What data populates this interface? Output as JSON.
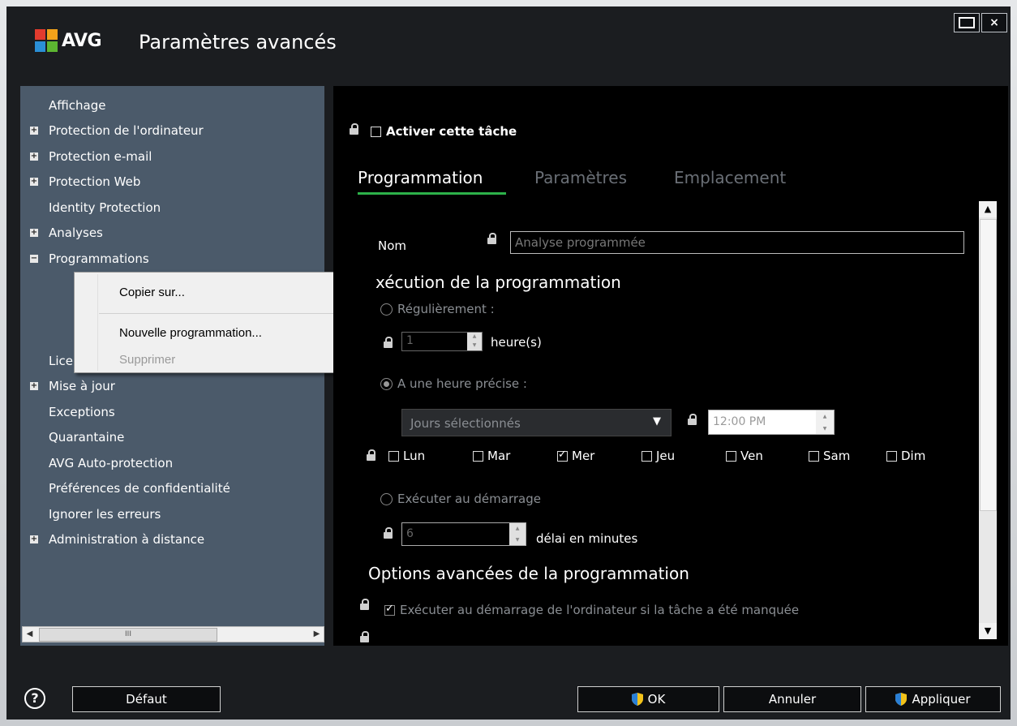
{
  "window": {
    "brand": "AVG",
    "title": "Paramètres avancés",
    "maximize_glyph": "",
    "close_glyph": "×"
  },
  "sidebar": {
    "items": [
      {
        "label": "Affichage",
        "expander": ""
      },
      {
        "label": "Protection de l'ordinateur",
        "expander": "+"
      },
      {
        "label": "Protection e-mail",
        "expander": "+"
      },
      {
        "label": "Protection Web",
        "expander": "+"
      },
      {
        "label": "Identity Protection",
        "expander": ""
      },
      {
        "label": "Analyses",
        "expander": "+"
      },
      {
        "label": "Programmations",
        "expander": "−"
      },
      {
        "label": "",
        "expander": ""
      },
      {
        "label": "",
        "expander": ""
      },
      {
        "label": "",
        "expander": ""
      },
      {
        "label": "Licence",
        "expander": ""
      },
      {
        "label": "Mise à jour",
        "expander": "+"
      },
      {
        "label": "Exceptions",
        "expander": ""
      },
      {
        "label": "Quarantaine",
        "expander": ""
      },
      {
        "label": "AVG Auto-protection",
        "expander": ""
      },
      {
        "label": "Préférences de confidentialité",
        "expander": ""
      },
      {
        "label": "Ignorer les erreurs",
        "expander": ""
      },
      {
        "label": "Administration à distance",
        "expander": "+"
      }
    ],
    "scroll_thumb_glyph": "III"
  },
  "context_menu": {
    "items": [
      {
        "label": "Copier sur...",
        "enabled": true
      },
      {
        "label": "Nouvelle programmation...",
        "enabled": true
      },
      {
        "label": "Supprimer",
        "enabled": false
      }
    ]
  },
  "panel": {
    "enable_task_label": "Activer cette tâche",
    "tabs": [
      "Programmation",
      "Paramètres",
      "Emplacement"
    ],
    "name_label": "Nom",
    "name_placeholder": "Analyse programmée",
    "execution_heading": "xécution de la programmation",
    "regularly_label": "Régulièrement :",
    "interval_value": "1",
    "interval_unit": "heure(s)",
    "specific_time_label": "A une heure précise :",
    "days_dropdown": "Jours sélectionnés",
    "time_value": "12:00 PM",
    "days": [
      {
        "label": "Lun",
        "checked": false
      },
      {
        "label": "Mar",
        "checked": false
      },
      {
        "label": "Mer",
        "checked": true
      },
      {
        "label": "Jeu",
        "checked": false
      },
      {
        "label": "Ven",
        "checked": false
      },
      {
        "label": "Sam",
        "checked": false
      },
      {
        "label": "Dim",
        "checked": false
      }
    ],
    "startup_label": "Exécuter au démarrage",
    "delay_value": "6",
    "delay_unit": "délai en minutes",
    "advanced_heading": "Options avancées de la programmation",
    "missed_task_label": "Exécuter au démarrage de l'ordinateur si la tâche a été manquée"
  },
  "footer": {
    "help_glyph": "?",
    "default_label": "Défaut",
    "ok_label": "OK",
    "cancel_label": "Annuler",
    "apply_label": "Appliquer"
  },
  "colors": {
    "window_bg": "#1b1d20",
    "sidebar_bg": "#4b5a6a",
    "tab_underline": "#2db24a"
  }
}
